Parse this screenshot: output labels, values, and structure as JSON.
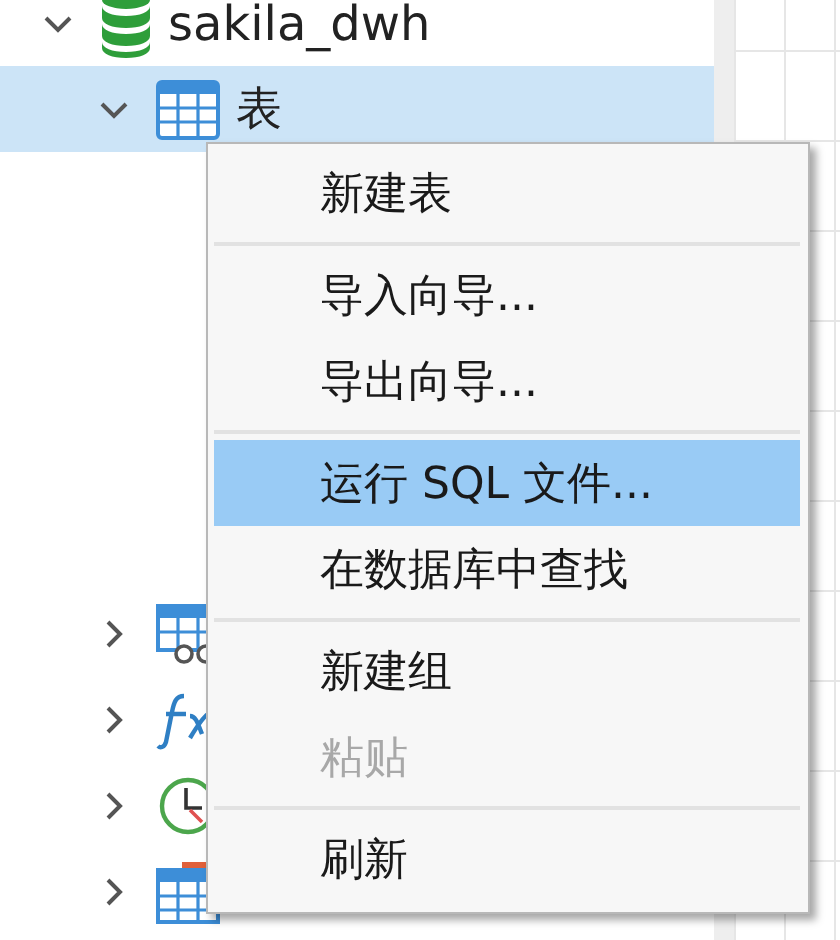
{
  "tree": [
    {
      "label": "sakila_dwh",
      "kind": "database",
      "expanded": true,
      "selected": false,
      "children": [
        {
          "label": "表",
          "kind": "tables",
          "expanded": true,
          "selected": true
        },
        {
          "kind": "views",
          "expanded": false,
          "selected": false
        },
        {
          "kind": "functions",
          "expanded": false,
          "selected": false
        },
        {
          "kind": "events",
          "expanded": false,
          "selected": false
        },
        {
          "kind": "reports",
          "expanded": false,
          "selected": false
        }
      ]
    }
  ],
  "context_menu": {
    "groups": [
      [
        {
          "label": "新建表",
          "selected": false,
          "disabled": false
        }
      ],
      [
        {
          "label": "导入向导...",
          "selected": false,
          "disabled": false
        },
        {
          "label": "导出向导...",
          "selected": false,
          "disabled": false
        }
      ],
      [
        {
          "label": "运行 SQL 文件...",
          "selected": true,
          "disabled": false
        },
        {
          "label": "在数据库中查找",
          "selected": false,
          "disabled": false
        }
      ],
      [
        {
          "label": "新建组",
          "selected": false,
          "disabled": false
        },
        {
          "label": "粘贴",
          "selected": false,
          "disabled": true
        }
      ],
      [
        {
          "label": "刷新",
          "selected": false,
          "disabled": false
        }
      ]
    ]
  }
}
